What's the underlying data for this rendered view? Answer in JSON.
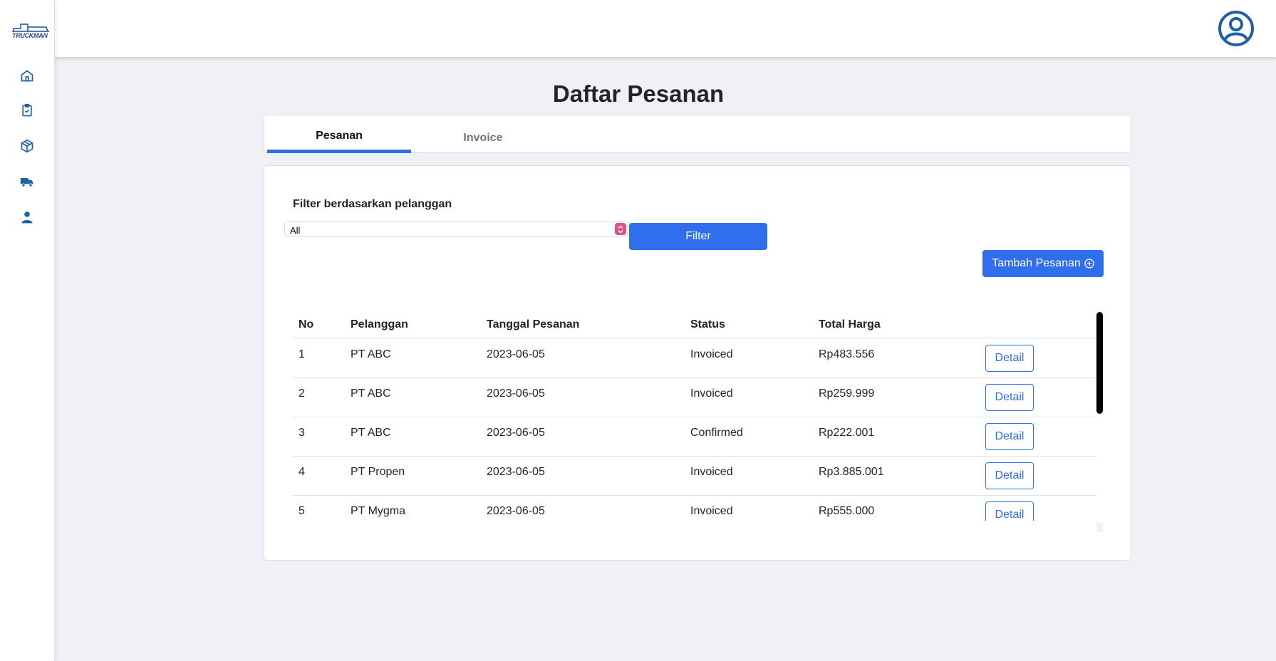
{
  "app": {
    "logo_text": "TRUCKMAN"
  },
  "sidebar": {
    "items": [
      {
        "icon": "home-icon"
      },
      {
        "icon": "clipboard-check-icon"
      },
      {
        "icon": "package-icon"
      },
      {
        "icon": "truck-icon"
      },
      {
        "icon": "user-icon"
      }
    ]
  },
  "header": {
    "avatar_icon": "user-circle-icon"
  },
  "page": {
    "title": "Daftar Pesanan"
  },
  "tabs": [
    {
      "label": "Pesanan",
      "active": true
    },
    {
      "label": "Invoice",
      "active": false
    }
  ],
  "filter": {
    "label": "Filter berdasarkan pelanggan",
    "selected": "All",
    "button_label": "Filter"
  },
  "add_button": {
    "label": "Tambah Pesanan",
    "icon": "plus-circle-icon"
  },
  "table": {
    "headers": {
      "no": "No",
      "pelanggan": "Pelanggan",
      "tanggal": "Tanggal Pesanan",
      "status": "Status",
      "total": "Total Harga"
    },
    "rows": [
      {
        "no": "1",
        "pelanggan": "PT ABC",
        "tanggal": "2023-06-05",
        "status": "Invoiced",
        "total": "Rp483.556",
        "action": "Detail"
      },
      {
        "no": "2",
        "pelanggan": "PT ABC",
        "tanggal": "2023-06-05",
        "status": "Invoiced",
        "total": "Rp259.999",
        "action": "Detail"
      },
      {
        "no": "3",
        "pelanggan": "PT ABC",
        "tanggal": "2023-06-05",
        "status": "Confirmed",
        "total": "Rp222.001",
        "action": "Detail"
      },
      {
        "no": "4",
        "pelanggan": "PT Propen",
        "tanggal": "2023-06-05",
        "status": "Invoiced",
        "total": "Rp3.885.001",
        "action": "Detail"
      },
      {
        "no": "5",
        "pelanggan": "PT Mygma",
        "tanggal": "2023-06-05",
        "status": "Invoiced",
        "total": "Rp555.000",
        "action": "Detail"
      }
    ]
  },
  "colors": {
    "primary": "#2f6fed",
    "sidebar_icon": "#1f5fa8",
    "background": "#eff1f6"
  }
}
